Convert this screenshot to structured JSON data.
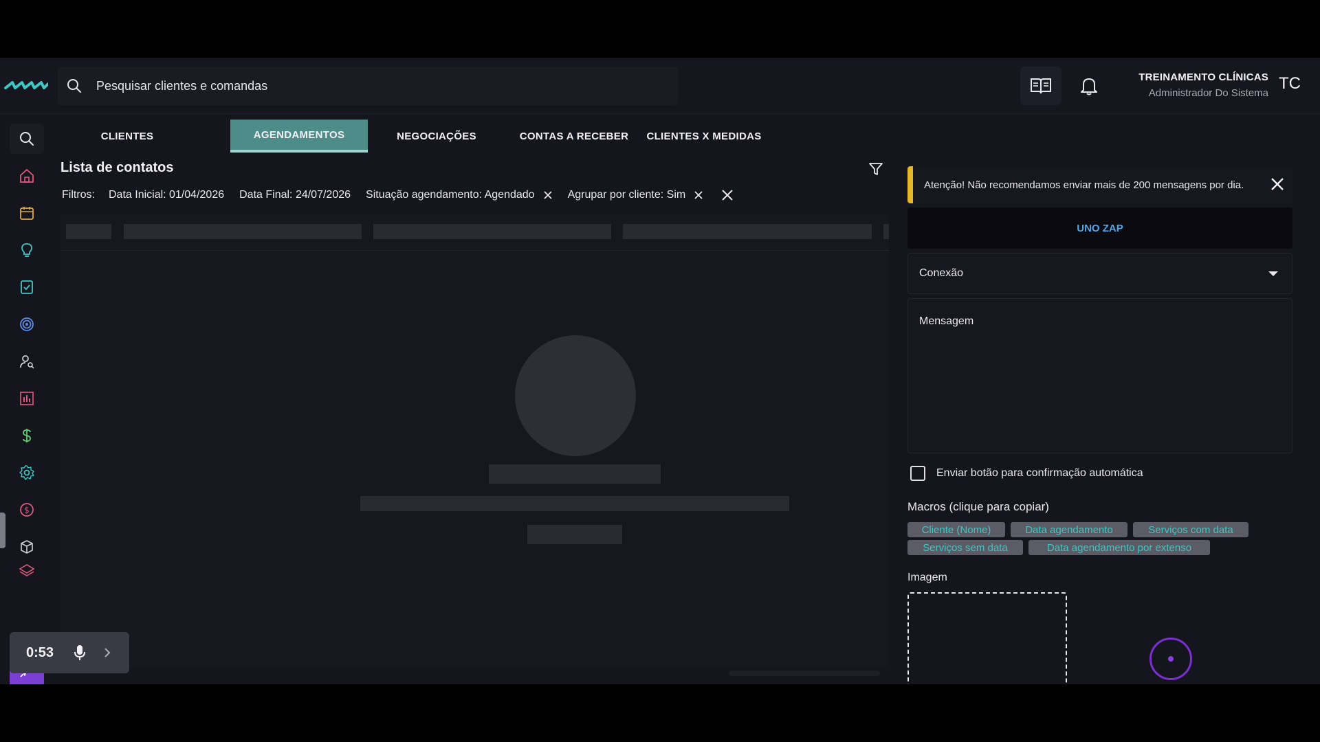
{
  "header": {
    "search_placeholder": "Pesquisar clientes e comandas",
    "user_name": "TREINAMENTO CLÍNICAS",
    "user_role": "Administrador Do Sistema",
    "avatar_initials": "TC",
    "accent_logo_color": "#3fc7c6"
  },
  "tabs": [
    {
      "label": "CLIENTES",
      "active": false
    },
    {
      "label": "AGENDAMENTOS",
      "active": true
    },
    {
      "label": "NEGOCIAÇÕES",
      "active": false
    },
    {
      "label": "CONTAS A RECEBER",
      "active": false
    },
    {
      "label": "CLIENTES X MEDIDAS",
      "active": false
    }
  ],
  "list": {
    "title": "Lista de contatos",
    "filters_label": "Filtros:",
    "filters": [
      {
        "text": "Data Inicial: 01/04/2026",
        "removable": false
      },
      {
        "text": "Data Final: 24/07/2026",
        "removable": false
      },
      {
        "text": "Situação agendamento: Agendado",
        "removable": true
      },
      {
        "text": "Agrupar por cliente: Sim",
        "removable": true
      }
    ]
  },
  "panel": {
    "alert": "Atenção! Não recomendamos enviar mais de 200 mensagens por dia.",
    "alert_color": "#e3b72a",
    "channel_button": "UNO ZAP",
    "connection_select": "Conexão",
    "message_label": "Mensagem",
    "auto_confirm_label": "Enviar botão para confirmação automática",
    "auto_confirm_checked": false,
    "macros_title": "Macros (clique para copiar)",
    "macros": [
      "Cliente (Nome)",
      "Data agendamento",
      "Serviços com data",
      "Serviços sem data",
      "Data agendamento por extenso"
    ],
    "image_label": "Imagem"
  },
  "recorder": {
    "time": "0:53"
  },
  "sidebar_icons": [
    "search-icon",
    "home-icon",
    "calendar-icon",
    "lightbulb-icon",
    "checklist-icon",
    "target-icon",
    "user-search-icon",
    "bar-chart-icon",
    "dollar-icon",
    "gear-icon",
    "coin-icon",
    "box-icon",
    "layers-icon",
    "sparkles-icon"
  ]
}
